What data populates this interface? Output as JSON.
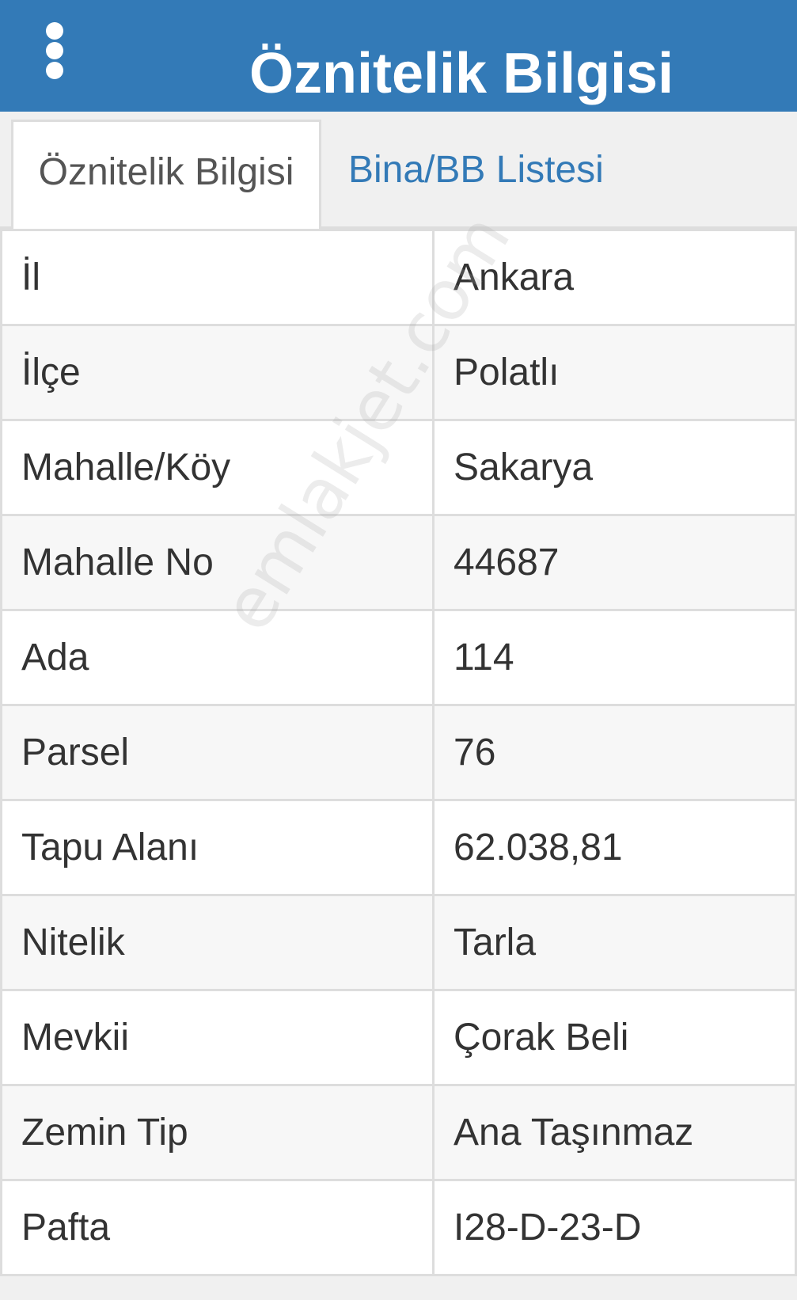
{
  "header": {
    "title": "Öznitelik Bilgisi",
    "menu_icon": "more-vertical-icon",
    "background_color": "#337ab7"
  },
  "tabs": [
    {
      "label": "Öznitelik Bilgisi",
      "active": true
    },
    {
      "label": "Bina/BB Listesi",
      "active": false
    }
  ],
  "rows": [
    {
      "label": "İl",
      "value": "Ankara"
    },
    {
      "label": "İlçe",
      "value": "Polatlı"
    },
    {
      "label": "Mahalle/Köy",
      "value": "Sakarya"
    },
    {
      "label": "Mahalle No",
      "value": "44687"
    },
    {
      "label": "Ada",
      "value": "114"
    },
    {
      "label": "Parsel",
      "value": "76"
    },
    {
      "label": "Tapu Alanı",
      "value": "62.038,81"
    },
    {
      "label": "Nitelik",
      "value": "Tarla"
    },
    {
      "label": "Mevkii",
      "value": "Çorak Beli"
    },
    {
      "label": "Zemin Tip",
      "value": "Ana Taşınmaz"
    },
    {
      "label": "Pafta",
      "value": "I28-D-23-D"
    }
  ],
  "watermark": "emlakjet.com"
}
